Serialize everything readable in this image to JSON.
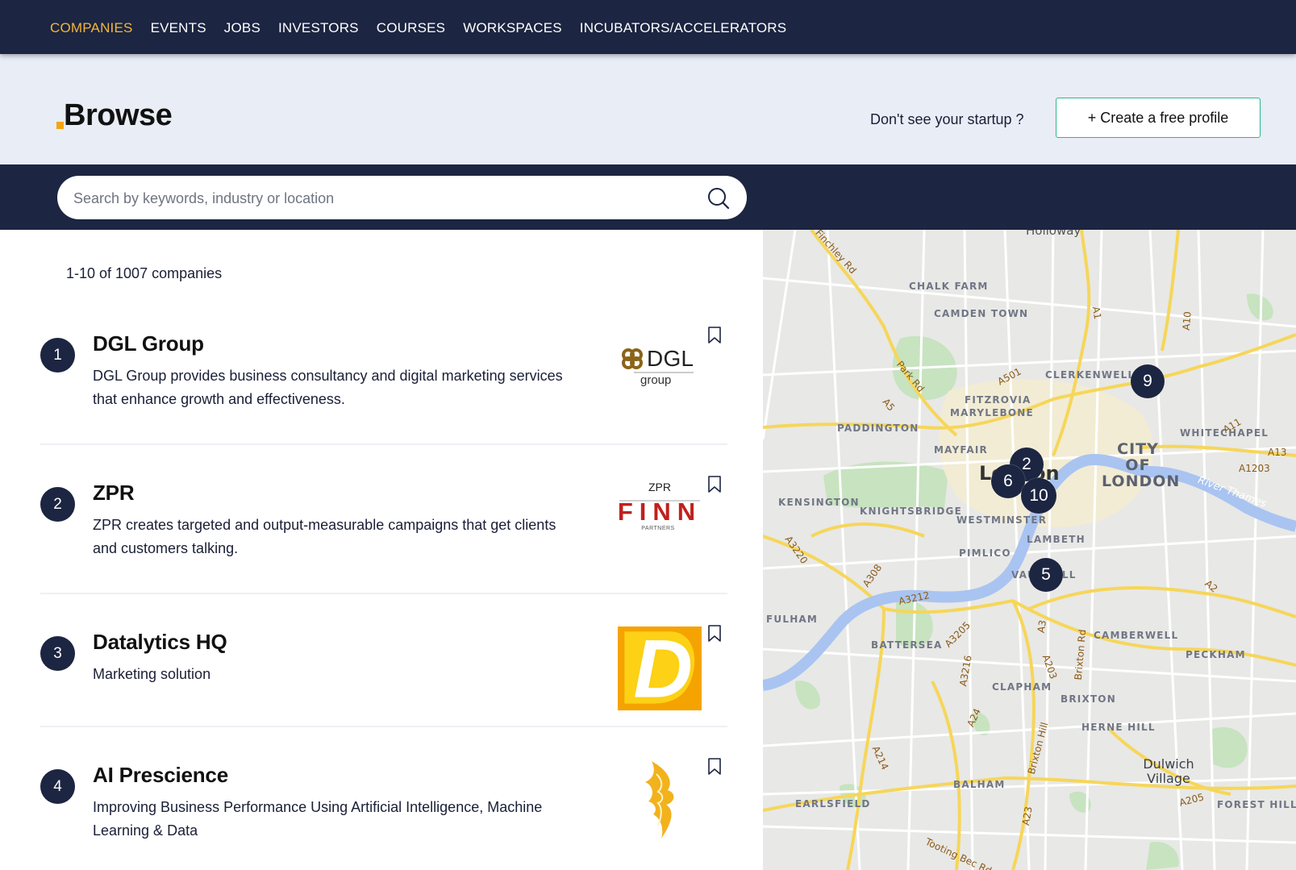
{
  "nav": {
    "items": [
      {
        "label": "COMPANIES",
        "active": true
      },
      {
        "label": "EVENTS",
        "active": false
      },
      {
        "label": "JOBS",
        "active": false
      },
      {
        "label": "INVESTORS",
        "active": false
      },
      {
        "label": "COURSES",
        "active": false
      },
      {
        "label": "WORKSPACES",
        "active": false
      },
      {
        "label": "INCUBATORS/ACCELERATORS",
        "active": false
      }
    ]
  },
  "header": {
    "title": "Browse",
    "prompt": "Don't see your startup ?",
    "create_button": "+ Create a free profile"
  },
  "search": {
    "placeholder": "Search by keywords, industry or location",
    "value": ""
  },
  "results": {
    "count_text": "1-10 of 1007 companies",
    "companies": [
      {
        "rank": "1",
        "name": "DGL Group",
        "description": "DGL Group provides business consultancy and digital marketing services that enhance growth and effectiveness.",
        "logo": "dgl-group-logo"
      },
      {
        "rank": "2",
        "name": "ZPR",
        "description": "ZPR creates targeted and output-measurable campaigns that get clients and customers talking.",
        "logo": "zpr-finn-partners-logo"
      },
      {
        "rank": "3",
        "name": "Datalytics HQ",
        "description": "Marketing solution",
        "logo": "datalytics-d-logo"
      },
      {
        "rank": "4",
        "name": "AI Prescience",
        "description": "Improving Business Performance Using Artificial Intelligence, Machine Learning & Data",
        "logo": "ai-prescience-phoenix-logo"
      }
    ]
  },
  "logos": {
    "dgl_text": "DGL",
    "dgl_sub": "group",
    "zpr_top": "ZPR",
    "zpr_main": "FINN",
    "zpr_sub": "PARTNERS",
    "datalytics_letter": "D"
  },
  "map": {
    "pins": [
      "9",
      "2",
      "6",
      "10",
      "5"
    ],
    "areas": [
      "CHALK FARM",
      "CAMDEN TOWN",
      "CLERKENWELL",
      "FITZROVIA",
      "MARYLEBONE",
      "PADDINGTON",
      "MAYFAIR",
      "KENSINGTON",
      "KNIGHTSBRIDGE",
      "WESTMINSTER",
      "LAMBETH",
      "PIMLICO",
      "VAUXHALL",
      "FULHAM",
      "BATTERSEA",
      "CAMBERWELL",
      "PECKHAM",
      "CLAPHAM",
      "BRIXTON",
      "HERNE HILL",
      "BALHAM",
      "EARLSFIELD",
      "FOREST HILL",
      "WHITECHAPEL",
      "Holloway"
    ],
    "city_of_london": "CITY OF LONDON",
    "london": "London",
    "dulwich": "Dulwich Village",
    "river": "River Thames",
    "roads": [
      "Finchley Rd",
      "A1",
      "A10",
      "A501",
      "A5",
      "Park Rd",
      "A11",
      "A13",
      "A1203",
      "A3220",
      "A308",
      "A3212",
      "A3205",
      "A3216",
      "A3",
      "A203",
      "Brixton Rd",
      "A2",
      "A205",
      "A24",
      "A214",
      "Brixton Hill",
      "A23",
      "Tooting Bec Rd"
    ]
  },
  "colors": {
    "navy": "#1c2541",
    "accent": "#f2b53b",
    "button_border": "#29b98a"
  }
}
